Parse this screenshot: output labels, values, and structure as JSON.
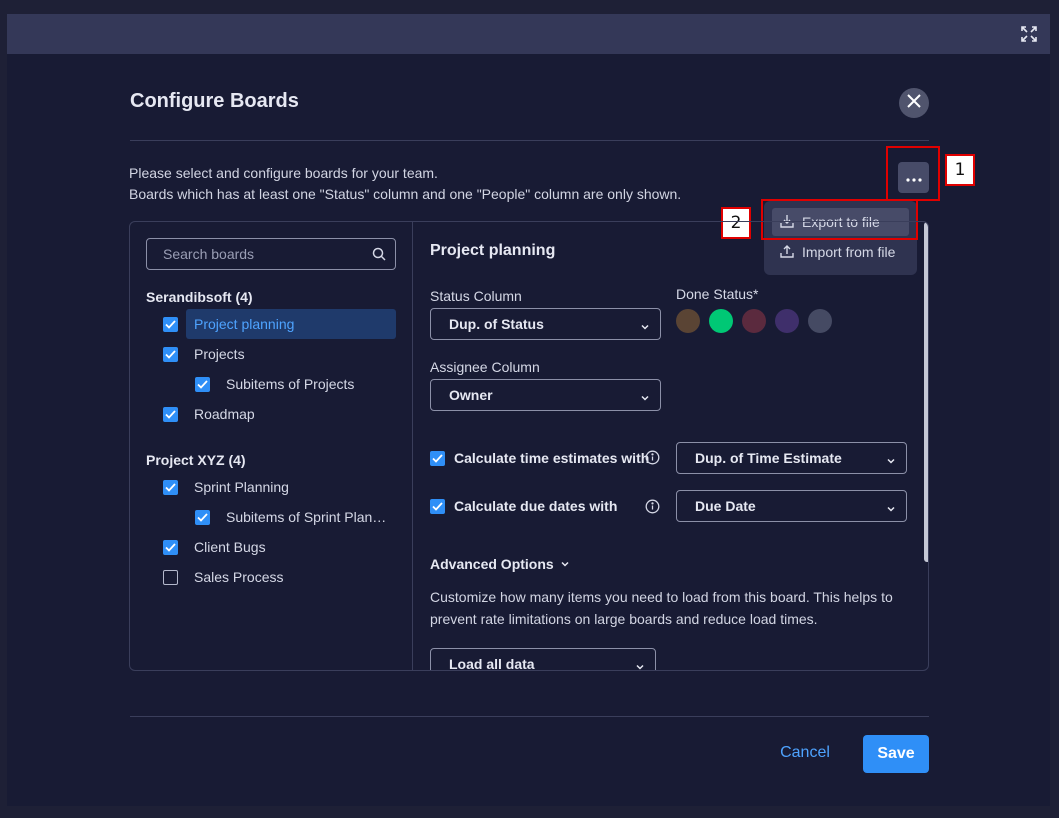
{
  "modal": {
    "title": "Configure Boards",
    "description_line1": "Please select and configure boards for your team.",
    "description_line2": "Boards which has at least one \"Status\" column and one \"People\" column are only shown.",
    "cancel_label": "Cancel",
    "save_label": "Save"
  },
  "annotations": {
    "label1": "1",
    "label2": "2"
  },
  "menu": {
    "items": [
      {
        "label": "Export to file",
        "icon": "download-icon"
      },
      {
        "label": "Import from file",
        "icon": "upload-icon"
      }
    ]
  },
  "sidebar": {
    "search_placeholder": "Search boards",
    "groups": [
      {
        "title": "Serandibsoft (4)",
        "boards": [
          {
            "label": "Project planning",
            "checked": true,
            "selected": true
          },
          {
            "label": "Projects",
            "checked": true
          },
          {
            "label": "Subitems of Projects",
            "checked": true,
            "sub": true
          },
          {
            "label": "Roadmap",
            "checked": true
          }
        ]
      },
      {
        "title": "Project XYZ (4)",
        "boards": [
          {
            "label": "Sprint Planning",
            "checked": true
          },
          {
            "label": "Subitems of Sprint Plan…",
            "checked": true,
            "sub": true
          },
          {
            "label": "Client Bugs",
            "checked": true
          },
          {
            "label": "Sales Process",
            "checked": false
          }
        ]
      }
    ]
  },
  "config": {
    "board_title": "Project planning",
    "status_column_label": "Status Column",
    "status_column_value": "Dup. of Status",
    "done_status_label": "Done Status*",
    "done_status_colors": [
      "#5a4434",
      "#00c875",
      "#5b2a3e",
      "#3f2f6b",
      "#454a63"
    ],
    "assignee_column_label": "Assignee Column",
    "assignee_column_value": "Owner",
    "time_estimate_label": "Calculate time estimates with",
    "time_estimate_value": "Dup. of Time Estimate",
    "due_date_label": "Calculate due dates with",
    "due_date_value": "Due Date",
    "advanced_label": "Advanced Options",
    "advanced_desc": "Customize how many items you need to load from this board. This helps to prevent rate limitations on large boards and reduce load times.",
    "load_value": "Load all data"
  }
}
